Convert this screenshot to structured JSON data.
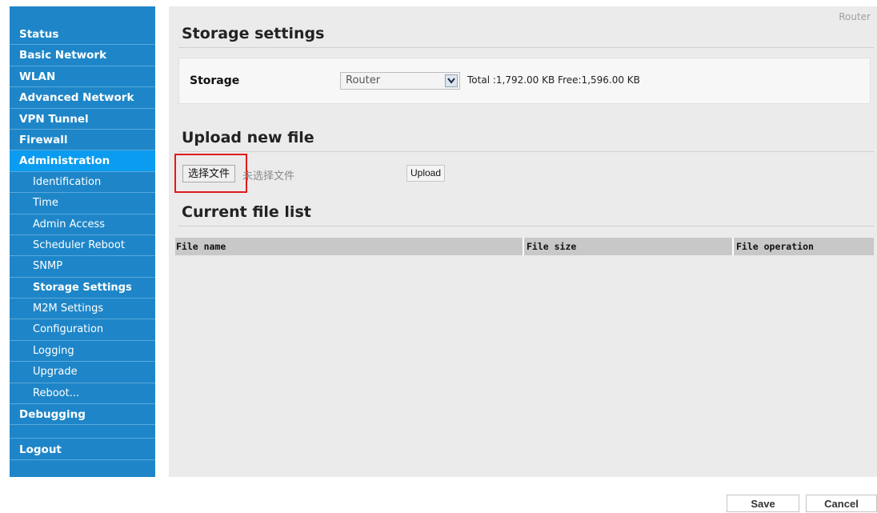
{
  "sidebar": {
    "items": [
      {
        "label": "Status",
        "level": "main"
      },
      {
        "label": "Basic Network",
        "level": "main"
      },
      {
        "label": "WLAN",
        "level": "main"
      },
      {
        "label": "Advanced Network",
        "level": "main"
      },
      {
        "label": "VPN Tunnel",
        "level": "main"
      },
      {
        "label": "Firewall",
        "level": "main"
      },
      {
        "label": "Administration",
        "level": "main"
      },
      {
        "label": "Identification",
        "level": "sub"
      },
      {
        "label": "Time",
        "level": "sub"
      },
      {
        "label": "Admin Access",
        "level": "sub"
      },
      {
        "label": "Scheduler Reboot",
        "level": "sub"
      },
      {
        "label": "SNMP",
        "level": "sub"
      },
      {
        "label": "Storage Settings",
        "level": "sub"
      },
      {
        "label": "M2M Settings",
        "level": "sub"
      },
      {
        "label": "Configuration",
        "level": "sub"
      },
      {
        "label": "Logging",
        "level": "sub"
      },
      {
        "label": "Upgrade",
        "level": "sub"
      },
      {
        "label": "Reboot...",
        "level": "sub"
      },
      {
        "label": "Debugging",
        "level": "main"
      }
    ],
    "logout": "Logout"
  },
  "header": {
    "device_label": "Router"
  },
  "storage_settings": {
    "title": "Storage settings",
    "storage_label": "Storage",
    "storage_selected": "Router",
    "storage_info": "Total :1,792.00 KB Free:1,596.00 KB"
  },
  "upload": {
    "title": "Upload new file",
    "choose_file_label": "选择文件",
    "no_file_text": "未选择文件",
    "upload_label": "Upload"
  },
  "file_list": {
    "title": "Current file list",
    "columns": [
      "File name",
      "File size",
      "File operation"
    ]
  },
  "footer": {
    "save_label": "Save",
    "cancel_label": "Cancel"
  },
  "colors": {
    "sidebar_bg": "#1e86c8",
    "sidebar_active_section": "#0a9cf0",
    "highlight_box": "#e01b1b"
  }
}
